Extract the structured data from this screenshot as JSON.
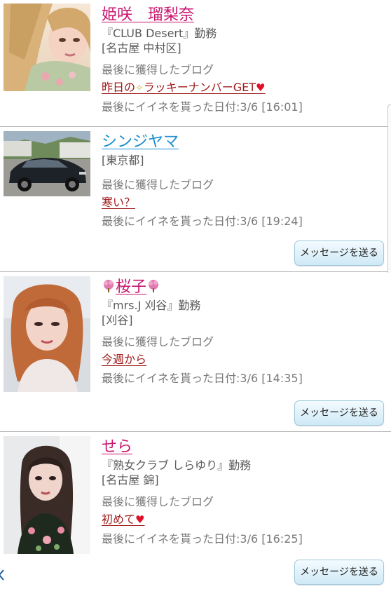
{
  "blog_label": "最後に獲得したブログ",
  "send_message_label": "メッセージを送る",
  "cards": [
    {
      "name": "姫咲　瑠梨奈",
      "shop": "『CLUB Desert』勤務",
      "area": "[名古屋 中村区]",
      "blog_prefix": "昨日の",
      "blog_suffix": "ラッキーナンバーGET",
      "blog_heart": "♥",
      "blog_sparkle": "✧",
      "last_liked": "最後にイイネを貰った日付:3/6 [16:01]"
    },
    {
      "name": "シンジヤマ",
      "area": "[東京都]",
      "blog_text": "寒い？",
      "last_liked": "最後にイイネを貰った日付:3/6 [19:24]"
    },
    {
      "name": "桜子",
      "shop": "『mrs.J 刈谷』勤務",
      "area": "[刈谷]",
      "blog_text": "今週から",
      "last_liked": "最後にイイネを貰った日付:3/6 [14:35]"
    },
    {
      "name": "せら",
      "shop": "『熟女クラブ しらゆり』勤務",
      "area": "[名古屋 錦]",
      "blog_text": "初めて",
      "blog_heart": "♥",
      "last_liked": "最後にイイネを貰った日付:3/6 [16:25]"
    }
  ],
  "colors": {
    "name_pink": "#c8156e",
    "name_blue": "#1a8fd0",
    "blog_link": "#a01a1a",
    "heart": "#e0102a",
    "button_bg": "#cfe9f6",
    "divider": "#b9b9b9"
  }
}
